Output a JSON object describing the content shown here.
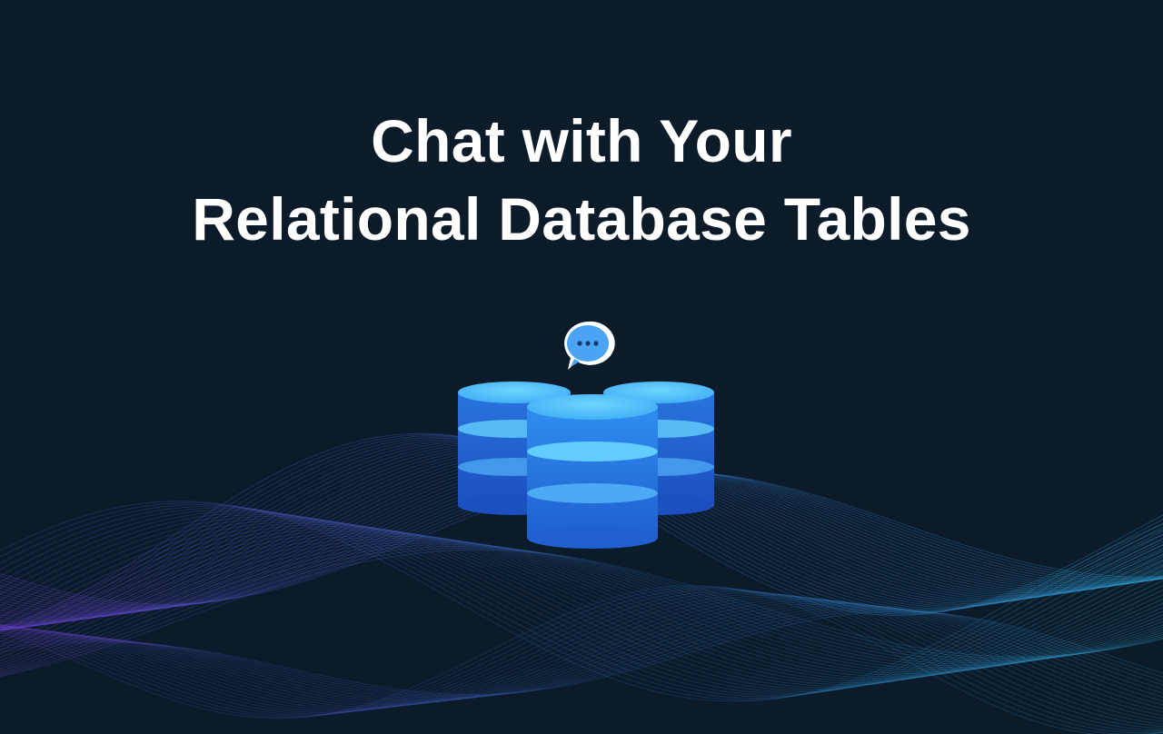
{
  "hero": {
    "title_line1": "Chat with Your",
    "title_line2": "Relational Database Tables"
  },
  "icons": {
    "chat": "chat-bubble-icon",
    "database": "database-icon"
  },
  "colors": {
    "background": "#0c1b2a",
    "title": "#ffffff",
    "db_top": "#5cc9ff",
    "db_body": "#2a82ea",
    "chat_bubble": "#4aa3f5",
    "wave_blue": "#2ea3d6",
    "wave_purple": "#6a3fd1"
  }
}
